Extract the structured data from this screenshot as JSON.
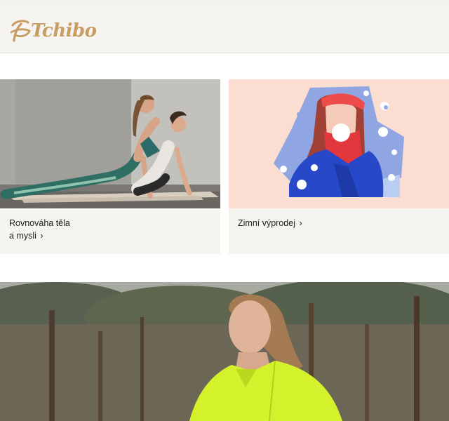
{
  "header": {
    "brand": "Tchibo",
    "logo_icon": "tchibo-bean-icon",
    "colors": {
      "brand_gold": "#c89d63",
      "background": "#f6f4f0"
    }
  },
  "cards": [
    {
      "line1": "Rovnováha těla",
      "line2": "a mysli",
      "chevron": "›",
      "image": "yoga-photo"
    },
    {
      "line1": "Zimní výprodej",
      "chevron": "›",
      "image": "winter-illustration"
    }
  ],
  "hero": {
    "image": "runner-photo"
  }
}
